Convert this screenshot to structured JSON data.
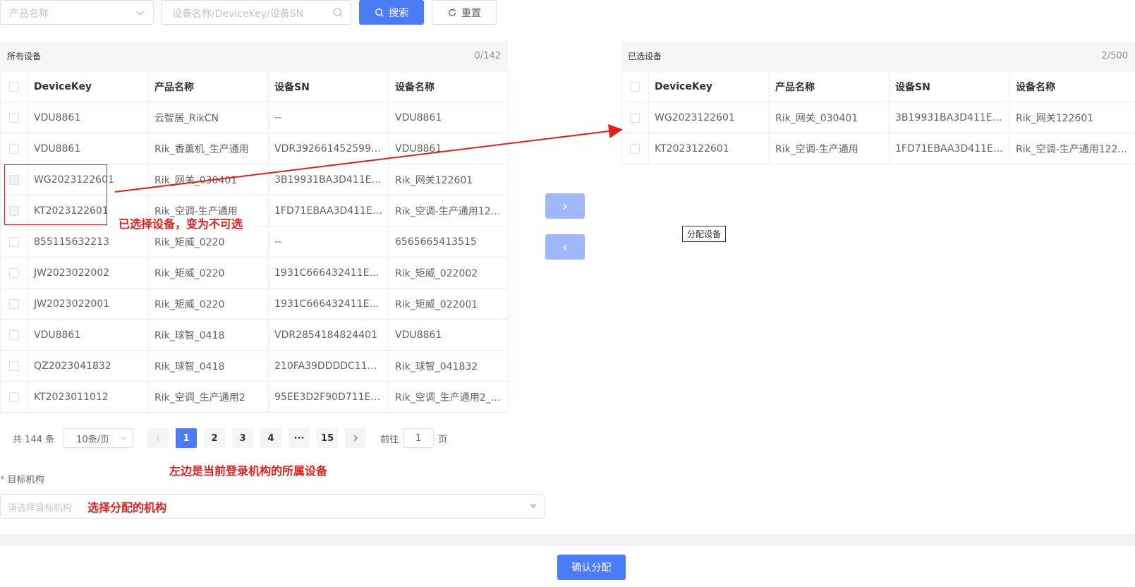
{
  "search": {
    "product_placeholder": "产品名称",
    "device_placeholder": "设备名称/DeviceKey/设备SN",
    "search_label": "搜索",
    "reset_label": "重置"
  },
  "left_panel": {
    "title": "所有设备",
    "count": "0/142",
    "columns": [
      "DeviceKey",
      "产品名称",
      "设备SN",
      "设备名称"
    ],
    "rows": [
      [
        "VDU8861",
        "云智居_RikCN",
        "--",
        "VDU8861"
      ],
      [
        "VDU8861",
        "Rik_香薰机_生产通用",
        "VDR39266145259931",
        "VDU8861"
      ],
      [
        "WG2023122601",
        "Rik_网关_030401",
        "3B19931BA3D411EEBE...",
        "Rik_网关122601"
      ],
      [
        "KT2023122601",
        "Rik_空调-生产通用",
        "1FD71EBAA3D411EEBE...",
        "Rik_空调-生产通用122..."
      ],
      [
        "855115632213",
        "Rik_矩威_0220",
        "--",
        "6565665413515"
      ],
      [
        "JW2023022002",
        "Rik_矩威_0220",
        "1931C666432411EEA3...",
        "Rik_矩威_022002"
      ],
      [
        "JW2023022001",
        "Rik_矩威_0220",
        "1931C666432411EEA3...",
        "Rik_矩威_022001"
      ],
      [
        "VDU8861",
        "Rik_球智_0418",
        "VDR2854184824401",
        "VDU8861"
      ],
      [
        "QZ2023041832",
        "Rik_球智_0418",
        "210FA39DDDDC11EDB...",
        "Rik_球智_041832"
      ],
      [
        "KT2023011012",
        "Rik_空调_生产通用2",
        "95EE3D2F90D711ED99...",
        "Rik_空调_生产通用2_0..."
      ]
    ]
  },
  "right_panel": {
    "title": "已选设备",
    "count": "2/500",
    "columns": [
      "DeviceKey",
      "产品名称",
      "设备SN",
      "设备名称"
    ],
    "rows": [
      [
        "WG2023122601",
        "Rik_网关_030401",
        "3B19931BA3D411EEBE...",
        "Rik_网关122601"
      ],
      [
        "KT2023122601",
        "Rik_空调-生产通用",
        "1FD71EBAA3D411EEBE...",
        "Rik_空调-生产通用122..."
      ]
    ]
  },
  "transfer": {
    "to_right": "›",
    "to_left": "‹",
    "tooltip": "分配设备"
  },
  "pagination": {
    "total": "共 144 条",
    "page_size": "10条/页",
    "pages": [
      "1",
      "2",
      "3",
      "4",
      "···",
      "15"
    ],
    "goto_prefix": "前往",
    "goto_value": "1",
    "goto_suffix": "页"
  },
  "target_org": {
    "label": "目标机构",
    "required_mark": "*",
    "placeholder": "请选择目标机构"
  },
  "annotations": {
    "selected_disabled": "已选择设备，变为不可选",
    "left_desc": "左边是当前登录机构的所属设备",
    "select_org": "选择分配的机构"
  },
  "confirm_label": "确认分配"
}
